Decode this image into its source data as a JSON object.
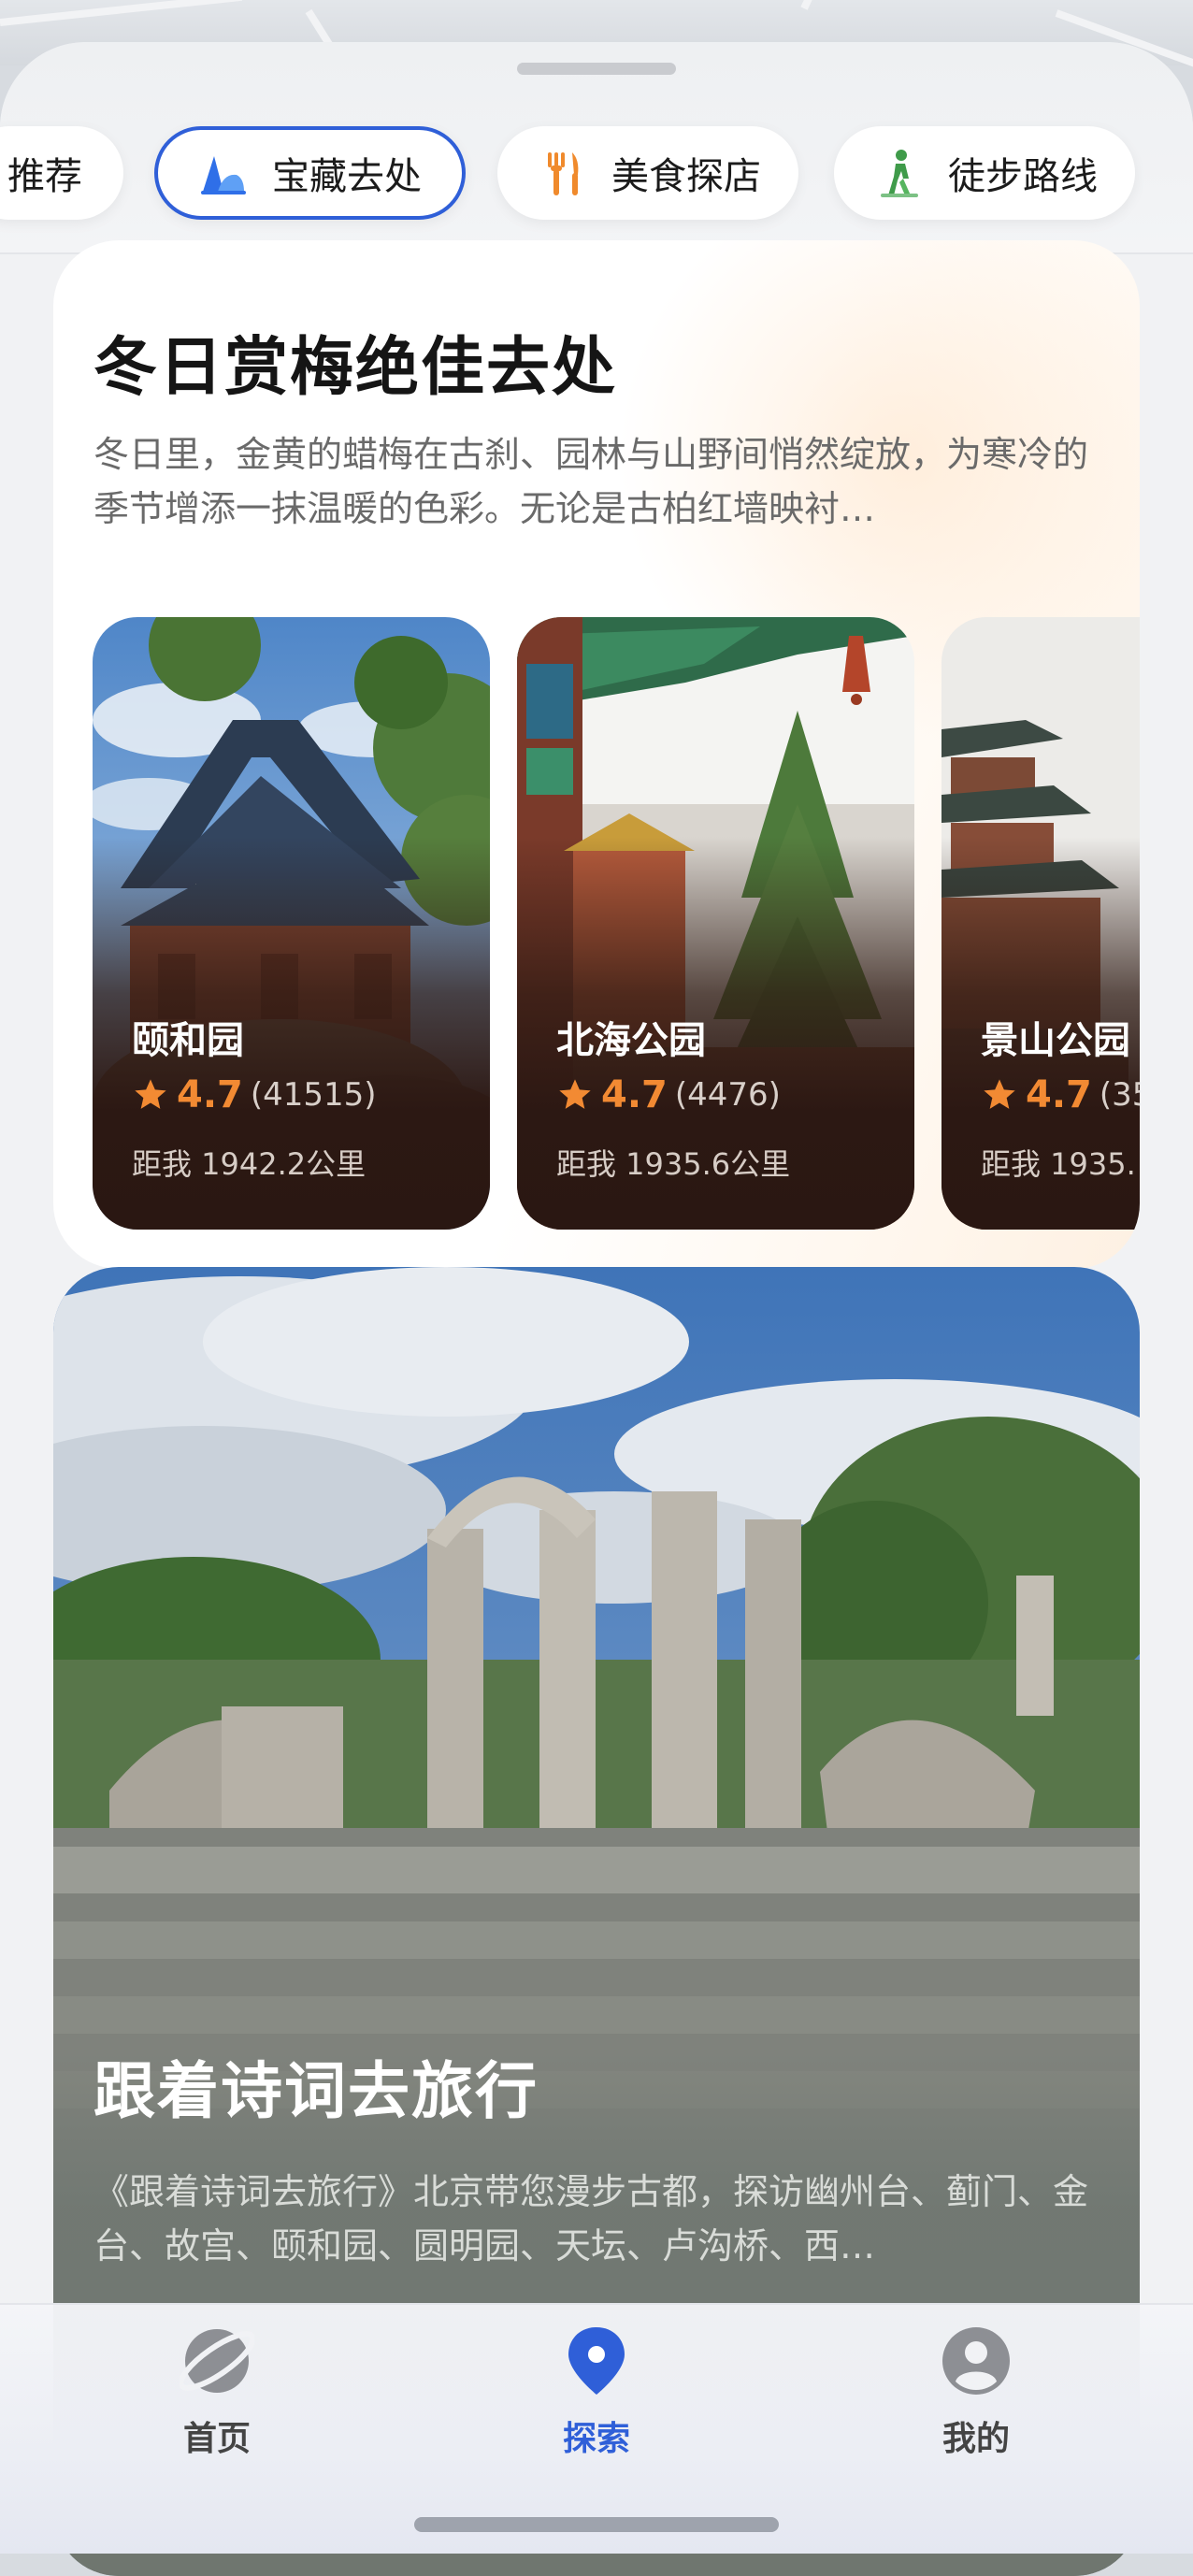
{
  "categories": [
    {
      "label": "推荐",
      "icon": "recommend-icon",
      "active": false
    },
    {
      "label": "宝藏去处",
      "icon": "treasure-place-icon",
      "active": true
    },
    {
      "label": "美食探店",
      "icon": "fork-knife-icon",
      "active": false
    },
    {
      "label": "徒步路线",
      "icon": "hiking-icon",
      "active": false
    }
  ],
  "feature": {
    "title": "冬日赏梅绝佳去处",
    "description": "冬日里，金黄的蜡梅在古刹、园林与山野间悄然绽放，为寒冷的季节增添一抹温暖的色彩。无论是古柏红墙映衬…",
    "places": [
      {
        "name": "颐和园",
        "rating": "4.7",
        "reviews": "(41515)",
        "distance": "距我 1942.2公里"
      },
      {
        "name": "北海公园",
        "rating": "4.7",
        "reviews": "(4476)",
        "distance": "距我 1935.6公里"
      },
      {
        "name": "景山公园",
        "rating": "4.7",
        "reviews": "(35",
        "distance": "距我 1935."
      }
    ]
  },
  "poetry": {
    "title": "跟着诗词去旅行",
    "description": "《跟着诗词去旅行》北京带您漫步古都，探访幽州台、蓟门、金台、故宫、颐和园、圆明园、天坛、卢沟桥、西…"
  },
  "nav": {
    "items": [
      {
        "label": "首页",
        "icon": "globe-icon",
        "active": false
      },
      {
        "label": "探索",
        "icon": "location-pin-icon",
        "active": true
      },
      {
        "label": "我的",
        "icon": "profile-icon",
        "active": false
      }
    ]
  },
  "colors": {
    "accent": "#2f5fd8",
    "rating": "#f28a33"
  }
}
